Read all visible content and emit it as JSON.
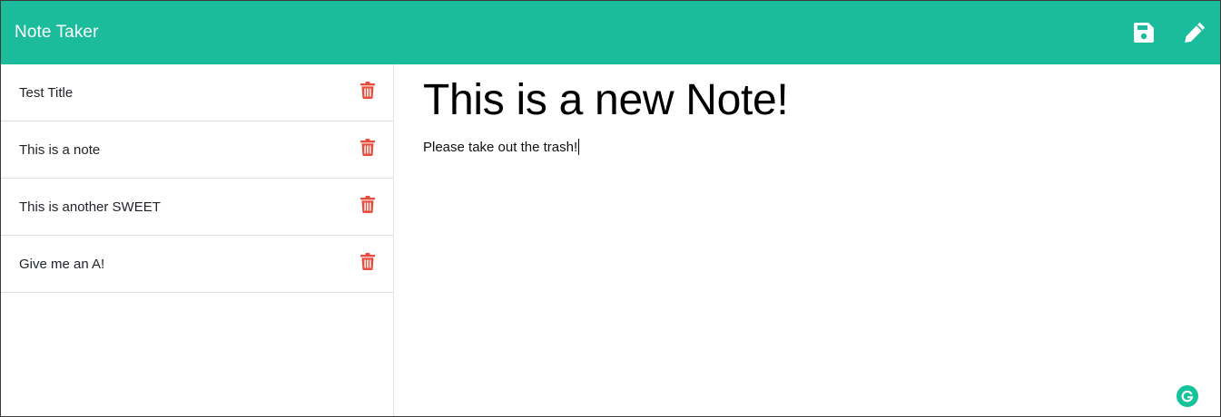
{
  "app": {
    "title": "Note Taker"
  },
  "navbar": {
    "background_color": "#1abc9c",
    "icons": [
      {
        "name": "save-icon"
      },
      {
        "name": "pencil-icon"
      }
    ]
  },
  "sidebar": {
    "items": [
      {
        "label": "Test Title",
        "icon": "trash-icon"
      },
      {
        "label": "This is a note",
        "icon": "trash-icon"
      },
      {
        "label": "This is another SWEET",
        "icon": "trash-icon"
      },
      {
        "label": "Give me an A!",
        "icon": "trash-icon"
      }
    ],
    "delete_icon_color": "#e74c3c"
  },
  "editor": {
    "title": "This is a new Note!",
    "body": "Please take out the trash!"
  },
  "grammarly": {
    "icon": "grammarly-icon",
    "color": "#15c39a"
  }
}
